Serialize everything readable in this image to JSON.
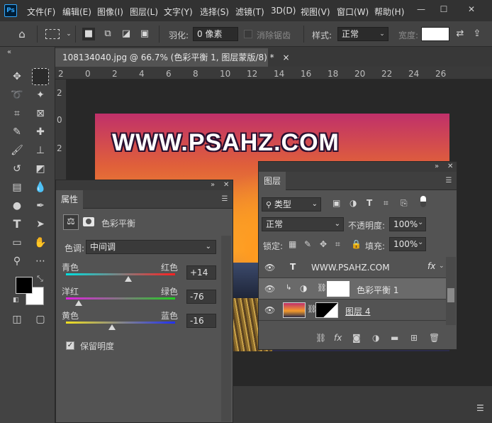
{
  "app": {
    "logo": "Ps"
  },
  "menu": [
    "文件(F)",
    "编辑(E)",
    "图像(I)",
    "图层(L)",
    "文字(Y)",
    "选择(S)",
    "滤镜(T)",
    "3D(D)",
    "视图(V)",
    "窗口(W)",
    "帮助(H)"
  ],
  "window_controls": {
    "minimize": "—",
    "maximize": "☐",
    "close": "✕"
  },
  "options_bar": {
    "feather_label": "羽化:",
    "feather_value": "0 像素",
    "antialias_label": "消除锯齿",
    "style_label": "样式:",
    "style_value": "正常",
    "width_label": "宽度:"
  },
  "document": {
    "tab_title": "108134040.jpg @ 66.7% (色彩平衡 1, 图层蒙版/8) *",
    "tab_close": "×",
    "ruler_top": [
      "2",
      "0",
      "2",
      "4",
      "6",
      "8",
      "10",
      "12",
      "14",
      "16",
      "18",
      "20",
      "22",
      "24",
      "26"
    ],
    "ruler_left": [
      "2",
      "0",
      "2"
    ],
    "image_text": "WWW.PSAHZ.COM"
  },
  "properties": {
    "tab": "属性",
    "adjustment_name": "色彩平衡",
    "tone_label": "色调:",
    "tone_value": "中间调",
    "sliders": [
      {
        "left": "青色",
        "right": "红色",
        "value": "+14",
        "level": 14,
        "min": -100,
        "max": 100
      },
      {
        "left": "洋红",
        "right": "绿色",
        "value": "-76",
        "level": -76,
        "min": -100,
        "max": 100
      },
      {
        "left": "黄色",
        "right": "蓝色",
        "value": "-16",
        "level": -16,
        "min": -100,
        "max": 100
      }
    ],
    "preserve_luminosity": "保留明度",
    "preserve_checked": true
  },
  "layers": {
    "tab": "图层",
    "filter_value": "类型",
    "blend_mode": "正常",
    "opacity_label": "不透明度:",
    "opacity_value": "100%",
    "lock_label": "锁定:",
    "fill_label": "填充:",
    "fill_value": "100%",
    "items": [
      {
        "name": "WWW.PSAHZ.COM",
        "kind": "text",
        "fx": "fx"
      },
      {
        "name": "色彩平衡 1",
        "kind": "adjustment",
        "selected": true
      },
      {
        "name": "图层 4",
        "kind": "pixel"
      }
    ]
  },
  "colors": {
    "accent": "#31a8ff",
    "foreground": "#000000",
    "background": "#ffffff"
  }
}
